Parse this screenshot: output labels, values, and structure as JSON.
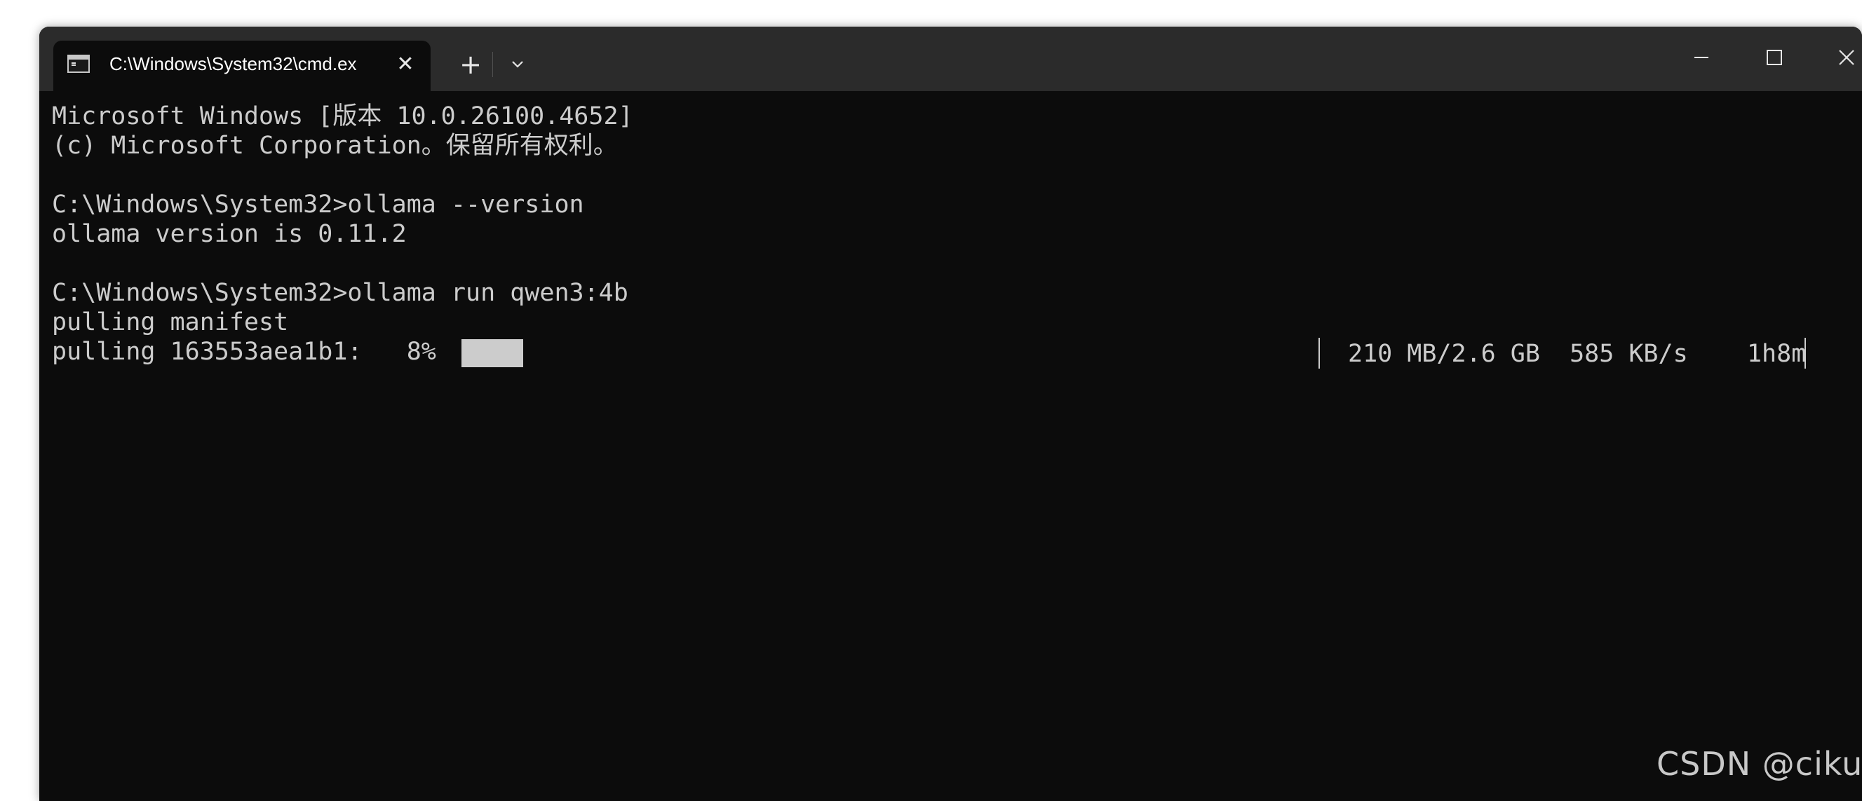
{
  "titlebar": {
    "tab_title": "C:\\Windows\\System32\\cmd.ex",
    "tab_icon": "terminal-icon",
    "tab_close_glyph": "✕",
    "new_tab_glyph": "+",
    "dropdown_icon": "chevron-down-icon",
    "window_controls": [
      "minimize-icon",
      "maximize-icon",
      "close-icon"
    ]
  },
  "terminal": {
    "lines": [
      "Microsoft Windows [版本 10.0.26100.4652]",
      "(c) Microsoft Corporation。保留所有权利。",
      "",
      "C:\\Windows\\System32>ollama --version",
      "ollama version is 0.11.2",
      "",
      "C:\\Windows\\System32>ollama run qwen3:4b",
      "pulling manifest",
      "pulling 163553aea1b1:   8%"
    ],
    "progress": {
      "percent": 8,
      "stats": "210 MB/2.6 GB  585 KB/s    1h8m"
    }
  },
  "watermark": "CSDN @ciku",
  "colors": {
    "terminal_bg": "#0c0c0c",
    "titlebar_bg": "#2b2b2b",
    "text": "#cccccc"
  }
}
